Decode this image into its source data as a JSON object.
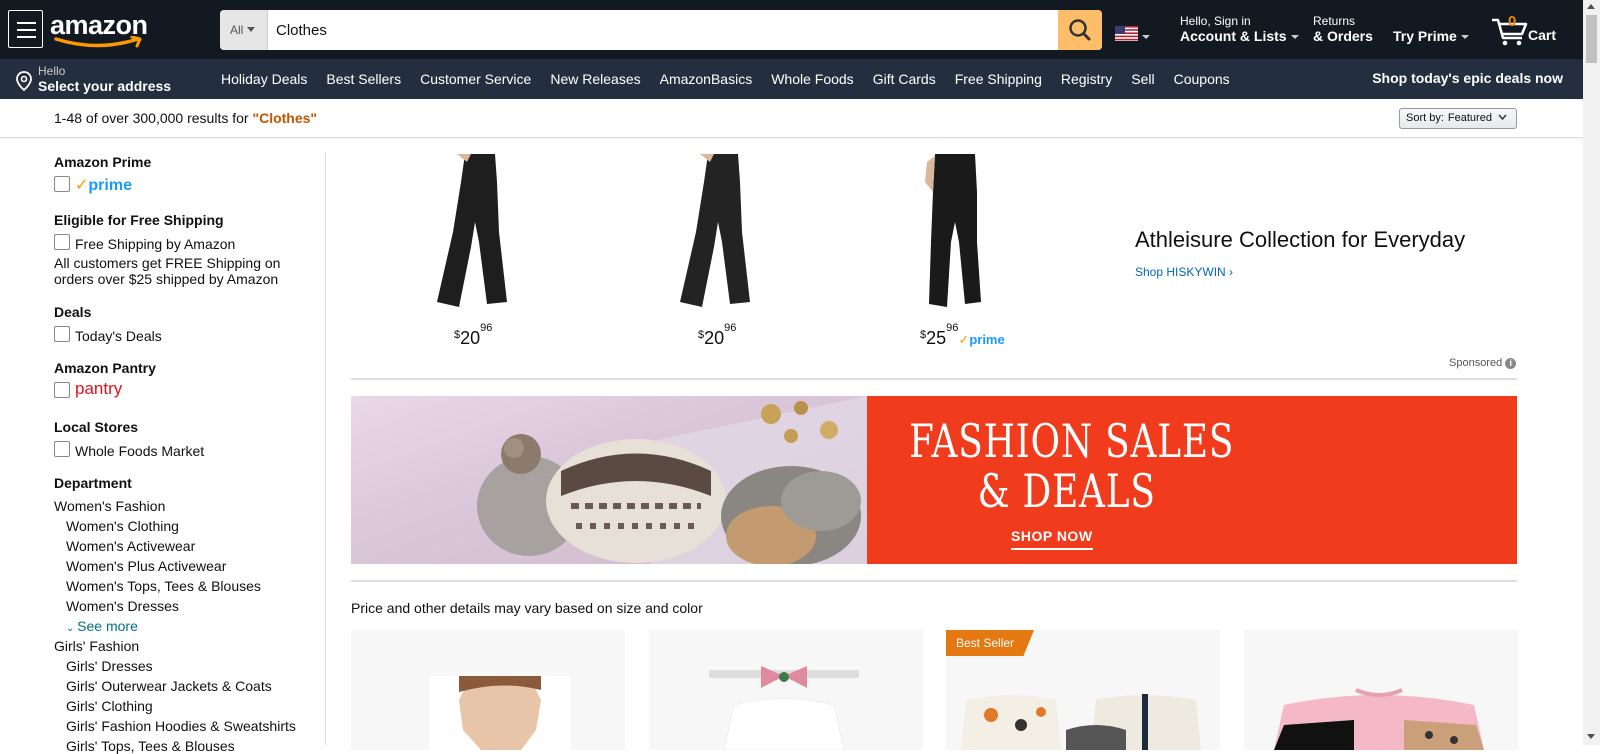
{
  "header": {
    "logo_text": "amazon",
    "search": {
      "category": "All",
      "value": "Clothes"
    },
    "account": {
      "line1": "Hello, Sign in",
      "line2": "Account & Lists"
    },
    "returns": {
      "line1": "Returns",
      "line2": "& Orders"
    },
    "prime": {
      "label": "Try Prime"
    },
    "cart": {
      "count": "0",
      "label": "Cart"
    }
  },
  "subnav": {
    "address": {
      "line1": "Hello",
      "line2": "Select your address"
    },
    "links": [
      "Holiday Deals",
      "Best Sellers",
      "Customer Service",
      "New Releases",
      "AmazonBasics",
      "Whole Foods",
      "Gift Cards",
      "Free Shipping",
      "Registry",
      "Sell",
      "Coupons"
    ],
    "promo": "Shop today's epic deals now"
  },
  "results": {
    "count_text": "1-48 of over 300,000 results for",
    "query": "\"Clothes\"",
    "sort_label": "Sort by:",
    "sort_value": "Featured"
  },
  "sidebar": {
    "amazon_prime": {
      "heading": "Amazon Prime",
      "prime_word": "prime"
    },
    "free_shipping": {
      "heading": "Eligible for Free Shipping",
      "option": "Free Shipping by Amazon",
      "note": "All customers get FREE Shipping on orders over $25 shipped by Amazon"
    },
    "deals": {
      "heading": "Deals",
      "option": "Today's Deals"
    },
    "pantry": {
      "heading": "Amazon Pantry",
      "word": "pantry"
    },
    "local_stores": {
      "heading": "Local Stores",
      "option": "Whole Foods Market"
    },
    "department": {
      "heading": "Department",
      "items": [
        "Women's Fashion",
        "Women's Clothing",
        "Women's Activewear",
        "Women's Plus Activewear",
        "Women's Tops, Tees & Blouses",
        "Women's Dresses",
        "See more",
        "Girls' Fashion",
        "Girls' Dresses",
        "Girls' Outerwear Jackets & Coats",
        "Girls' Clothing",
        "Girls' Fashion Hoodies & Sweatshirts",
        "Girls' Tops, Tees & Blouses"
      ]
    }
  },
  "sponsored": {
    "items": [
      {
        "price_whole": "20",
        "price_frac": "96",
        "symbol": "$",
        "prime": ""
      },
      {
        "price_whole": "20",
        "price_frac": "96",
        "symbol": "$",
        "prime": ""
      },
      {
        "price_whole": "25",
        "price_frac": "96",
        "symbol": "$",
        "prime": "prime"
      }
    ],
    "headline": "Athleisure Collection for Everyday",
    "link": "Shop HISKYWIN ›",
    "label": "Sponsored"
  },
  "banner": {
    "title_line1": "FASHION SALES",
    "title_line2": "& DEALS",
    "cta": "SHOP NOW"
  },
  "notice": "Price and other details may vary based on size and color",
  "cards": [
    {
      "badge": ""
    },
    {
      "badge": ""
    },
    {
      "badge": "Best Seller"
    },
    {
      "badge": ""
    }
  ],
  "colors": {
    "nav_dark": "#131921",
    "nav_sub": "#232f3e",
    "search_button": "#febd69",
    "accent_orange": "#c45500",
    "link_teal": "#007185",
    "banner_red": "#f03b1c",
    "badge_orange": "#e47911"
  }
}
